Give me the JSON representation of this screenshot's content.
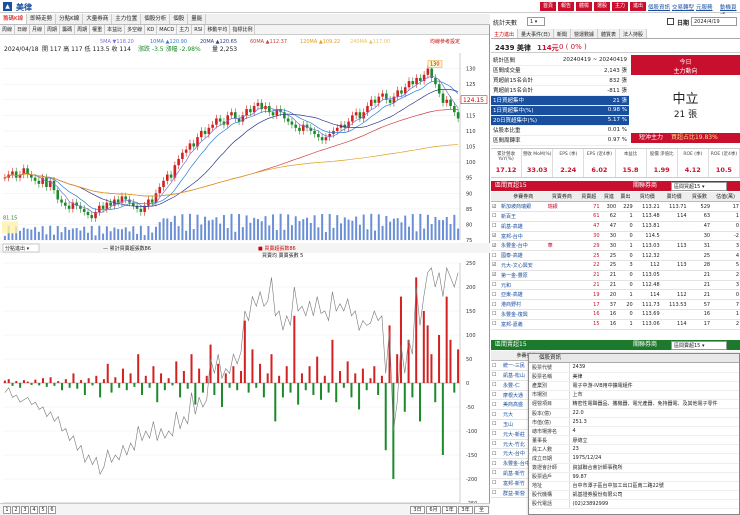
{
  "app": {
    "title": "美律"
  },
  "header_buttons": [
    "首頁",
    "報告",
    "體檢",
    "選股",
    "主力",
    "進出"
  ],
  "header_links": [
    "個股資訊",
    "交易轉型",
    "元服務",
    "動機頁式"
  ],
  "chart_tabs": [
    "籌碼K線",
    "即時走勢",
    "分點K線",
    "大量券商",
    "主力位置",
    "個股分析",
    "個股",
    "量能"
  ],
  "chart_toolbar": [
    "周線",
    "日線",
    "月線",
    "周期",
    "籌碼",
    "周期",
    "權重",
    "本益比",
    "多空線",
    "KD",
    "MACD",
    "主力",
    "RSI",
    "移動平均",
    "指標比例"
  ],
  "ma_legend": [
    {
      "label": "5MA ▼118.20",
      "color": "#7a6fd6"
    },
    {
      "label": "10MA ▲120.90",
      "color": "#2e7fd6"
    },
    {
      "label": "20MA ▲120.65",
      "color": "#2b3a88"
    },
    {
      "label": "60MA ▲112.37",
      "color": "#d04040"
    },
    {
      "label": "120MA ▲109.22",
      "color": "#e0a020"
    },
    {
      "label": "240MA ▲117.00",
      "color": "#f0c060"
    }
  ],
  "ma_note": "均線參考設定",
  "price_info": {
    "date": "2024/04/18",
    "text": "開 117  高 117  低 113.5  收 114",
    "change": "漲跌 -3.5  漲幅 -2.98%",
    "volume": "量 2,253"
  },
  "price_badge": "124.15",
  "peak_label": "130",
  "low_label": "81.15",
  "price_axis": [
    "130",
    "125",
    "120",
    "115",
    "110",
    "105",
    "100",
    "95",
    "90",
    "85",
    "80",
    "75"
  ],
  "lower_legend": {
    "left": "累計買賣超張数86",
    "right": "買賣超張数86",
    "right2": "買賣均 賣賣張數 5"
  },
  "lower_select": "分點進出",
  "lower_axis": [
    "250",
    "200",
    "150",
    "100",
    "50",
    "0",
    "-50",
    "-100",
    "-150",
    "-200",
    "-250"
  ],
  "date_axis": [
    {
      "lbl": "8/15",
      "sub": "2023"
    },
    {
      "lbl": "9/01",
      "sub": ""
    },
    {
      "lbl": "10/02",
      "sub": ""
    },
    {
      "lbl": "11/01",
      "sub": ""
    },
    {
      "lbl": "12/01",
      "sub": ""
    },
    {
      "lbl": "1/02",
      "sub": "2024"
    },
    {
      "lbl": "2/01",
      "sub": ""
    },
    {
      "lbl": "3/01",
      "sub": ""
    },
    {
      "lbl": "4/01",
      "sub": ""
    },
    {
      "lbl": "2024/04/18",
      "sub": ""
    }
  ],
  "pager": {
    "pages": [
      "1",
      "2",
      "3",
      "4",
      "5",
      "6"
    ],
    "ranges": [
      "3日",
      "6月",
      "1年",
      "3年",
      "全"
    ]
  },
  "right": {
    "period_label": "統計天數",
    "period_value": "1",
    "date_label": "日期",
    "date_value": "2024/4/19",
    "tabs": [
      "主力進出",
      "量大事件(日)",
      "新聞",
      "營運數據",
      "體質表",
      "法人持股"
    ],
    "stock": "2439 美律",
    "price": "114元",
    "price_change": "0 ( 0% )",
    "summary": [
      {
        "k": "統計區間",
        "v": "20240419 ~ 20240419"
      },
      {
        "k": "區間成交量",
        "v": "2,143 張"
      },
      {
        "k": "買超前15名合計",
        "v": "832 張"
      },
      {
        "k": "賣超前15名合計",
        "v": "-811 張"
      },
      {
        "k": "1日買超集中",
        "v": "21 張"
      },
      {
        "k": "1日買超集中(%)",
        "v": "0.98 %"
      },
      {
        "k": "20日買超集中(%)",
        "v": "5.17 %"
      },
      {
        "k": "佔股本比重",
        "v": "0.01 %"
      },
      {
        "k": "區間周轉率",
        "v": "0.97 %"
      }
    ],
    "today_title": "今日",
    "today_sub": "主力動向",
    "today_status": "中立",
    "today_amount": "21 張",
    "short_label": "短沖主力",
    "short_value": "買超占比19.83%",
    "metrics": [
      {
        "k": "累計營收 YoY(%)",
        "v": "17.12"
      },
      {
        "k": "營收 MoM(%)",
        "v": "33.03"
      },
      {
        "k": "EPS (季)",
        "v": "2.24"
      },
      {
        "k": "EPS (近4季)",
        "v": "6.02"
      },
      {
        "k": "本益比",
        "v": "15.8"
      },
      {
        "k": "股價 淨值比",
        "v": "1.99"
      },
      {
        "k": "ROE (季)",
        "v": "4.12"
      },
      {
        "k": "ROE (近4季)",
        "v": "10.5"
      }
    ],
    "buy_header": "區間買超15",
    "broker_select": "關聯券商",
    "broker_select_value": "區間買超15",
    "col_headers": [
      "",
      "參賽券商",
      "買賣券商",
      "買賣超",
      "買進",
      "賣出",
      "買均價",
      "賣均價",
      "買張數",
      "估值(萬)"
    ],
    "buy_rows": [
      [
        "新加坡商瑞銀",
        "瑞銀",
        "71",
        "300",
        "229",
        "113.21",
        "113.71",
        "529",
        "17"
      ],
      [
        "新百王",
        "",
        "61",
        "62",
        "1",
        "113.48",
        "114",
        "63",
        "1"
      ],
      [
        "凱基-高雄",
        "",
        "47",
        "47",
        "0",
        "113.81",
        "",
        "47",
        "0"
      ],
      [
        "富邦-台中",
        "",
        "30",
        "30",
        "0",
        "114.5",
        "",
        "30",
        "-2"
      ],
      [
        "永豐金-台中",
        "華",
        "29",
        "30",
        "1",
        "113.03",
        "113",
        "31",
        "3"
      ],
      [
        "國泰-高雄",
        "",
        "25",
        "25",
        "0",
        "112.32",
        "",
        "25",
        "4"
      ],
      [
        "元大-文心興安",
        "",
        "22",
        "25",
        "3",
        "112",
        "113",
        "28",
        "5"
      ],
      [
        "第一金-豐原",
        "",
        "21",
        "21",
        "0",
        "113.05",
        "",
        "21",
        "2"
      ],
      [
        "元和",
        "",
        "21",
        "21",
        "0",
        "112.48",
        "",
        "21",
        "3"
      ],
      [
        "亞東-高雄",
        "",
        "19",
        "20",
        "1",
        "114",
        "112",
        "21",
        "0"
      ],
      [
        "港商野村",
        "",
        "17",
        "37",
        "20",
        "111.73",
        "113.53",
        "57",
        "7"
      ],
      [
        "永豐金-復興",
        "",
        "16",
        "16",
        "0",
        "113.69",
        "",
        "16",
        "1"
      ],
      [
        "富邦-嘉義",
        "",
        "15",
        "16",
        "1",
        "113.06",
        "114",
        "17",
        "2"
      ]
    ],
    "sell_header": "區間賣超15",
    "sell_select_value": "區間賣超15",
    "sell_rows": [
      [
        "統一-三民"
      ],
      [
        "凱基-松山"
      ],
      [
        "永豐-仁"
      ],
      [
        "摩根大通"
      ],
      [
        "美商高盛"
      ],
      [
        "元大"
      ],
      [
        "玉山"
      ],
      [
        "元大-新莊"
      ],
      [
        "元大-竹北"
      ],
      [
        "元大-台中"
      ],
      [
        "永豐金-台中"
      ],
      [
        "凱基-新竹"
      ],
      [
        "富邦-新竹"
      ],
      [
        "群益-新營"
      ]
    ]
  },
  "popup": {
    "title": "個股資訊",
    "rows": [
      {
        "k": "股票代號",
        "v": "2439"
      },
      {
        "k": "股票名稱",
        "v": "美律"
      },
      {
        "k": "產業別",
        "v": "電子中游-IVB用中擴電組件"
      },
      {
        "k": "市場別",
        "v": "上市"
      },
      {
        "k": "經營項目",
        "v": "精密性電聲器品、攜機器、電光產器、免持器電、及其他電子零件"
      },
      {
        "k": "股本(億)",
        "v": "22.0"
      },
      {
        "k": "市值(億)",
        "v": "251.3"
      },
      {
        "k": "總市場排名",
        "v": "4"
      },
      {
        "k": "董事長",
        "v": "廖總立"
      },
      {
        "k": "員工人數",
        "v": "23"
      },
      {
        "k": "成立日期",
        "v": "1975/12/24"
      },
      {
        "k": "簽證會計師",
        "v": "資誠聯合會計師事務所"
      },
      {
        "k": "股票過戶",
        "v": "99.87"
      },
      {
        "k": "地址",
        "v": "台中市潭子區台中加工出口區南二路22號"
      },
      {
        "k": "股代機構",
        "v": "凱基證券股份有限公司"
      },
      {
        "k": "股代電話",
        "v": "(02)23892999"
      }
    ]
  },
  "colors": {
    "up": "#d32020",
    "down": "#1b8a2b",
    "accent": "#c8102e",
    "green": "#1d7a2c"
  },
  "chart_data": {
    "type": "candlestick+bar",
    "title": "美律 2439",
    "close_series": [
      95,
      96,
      97,
      95,
      96,
      98,
      96,
      95,
      94,
      93,
      95,
      92,
      94,
      91,
      88,
      87,
      86,
      85,
      87,
      86,
      85,
      84,
      83,
      82,
      84,
      86,
      85,
      87,
      86,
      88,
      87,
      89,
      88,
      87,
      86,
      85,
      84,
      86,
      88,
      87,
      90,
      92,
      94,
      96,
      95,
      99,
      101,
      103,
      104,
      106,
      105,
      108,
      110,
      109,
      111,
      112,
      114,
      113,
      112,
      115,
      116,
      114,
      113,
      115,
      117,
      116,
      118,
      119,
      117,
      118,
      116,
      115,
      117,
      116,
      114,
      113,
      112,
      111,
      110,
      112,
      111,
      110,
      109,
      108,
      107,
      108,
      109,
      110,
      111,
      112,
      111,
      113,
      115,
      116,
      114,
      116,
      118,
      120,
      119,
      121,
      122,
      120,
      119,
      121,
      123,
      122,
      124,
      126,
      125,
      127,
      126,
      128,
      130,
      127,
      125,
      122,
      119,
      120,
      118,
      116,
      114
    ],
    "ylim": [
      75,
      135
    ],
    "lower_values": [
      5,
      8,
      -6,
      4,
      -10,
      6,
      3,
      -4,
      7,
      -5,
      10,
      -8,
      12,
      -6,
      4,
      -15,
      8,
      -10,
      20,
      -12,
      6,
      -25,
      10,
      -5,
      15,
      -30,
      8,
      40,
      -20,
      12,
      -10,
      30,
      -15,
      20,
      -8,
      60,
      -25,
      15,
      -10,
      35,
      -40,
      20,
      -15,
      10,
      -5,
      45,
      -30,
      25,
      -12,
      60,
      -45,
      30,
      -20,
      15,
      80,
      -25,
      40,
      -50,
      20,
      -10,
      35,
      -15,
      25,
      130,
      -20,
      70,
      -10,
      40,
      -30,
      20,
      60,
      -80,
      15,
      -30,
      35,
      -20,
      140,
      -45,
      20,
      -15,
      35,
      -25,
      55,
      -35,
      15,
      -20,
      90,
      -40,
      25,
      -10,
      45,
      -30,
      20,
      -55,
      30,
      -15,
      10,
      35,
      -25,
      15,
      -140,
      120,
      -200,
      60,
      180,
      -60,
      90,
      -30,
      220,
      -80,
      150,
      120,
      60,
      -40,
      100,
      -150,
      180,
      90,
      -20,
      70
    ],
    "lower_cum": [
      -20,
      -10,
      -30,
      -25,
      -40,
      -35,
      -30,
      -45,
      -40,
      -55,
      -50,
      -70,
      -60,
      -80,
      -70,
      -100,
      -95,
      -120,
      -110,
      -140,
      -130,
      -165,
      -150,
      -170,
      -155,
      -190,
      -175,
      -140,
      -165,
      -150,
      -160,
      -130,
      -150,
      -125,
      -140,
      -90,
      -120,
      -100,
      -115,
      -80,
      -120,
      -95,
      -115,
      -100,
      -110,
      -60,
      -95,
      -70,
      -85,
      -20,
      -65,
      -30,
      -50,
      -35,
      50,
      20,
      60,
      10,
      30,
      20,
      60,
      40,
      65,
      150,
      130,
      180,
      160,
      190,
      160,
      170,
      220,
      140,
      150,
      110,
      140,
      120,
      200,
      150,
      160,
      140,
      170,
      140,
      180,
      145,
      150,
      130,
      190,
      150,
      165,
      150,
      175,
      140,
      150,
      110,
      130,
      120,
      125,
      150,
      130,
      140,
      20,
      110,
      -100,
      -40,
      80,
      20,
      90,
      60,
      200,
      120,
      180,
      230,
      240,
      200,
      230,
      180,
      240,
      220,
      200,
      230
    ]
  }
}
